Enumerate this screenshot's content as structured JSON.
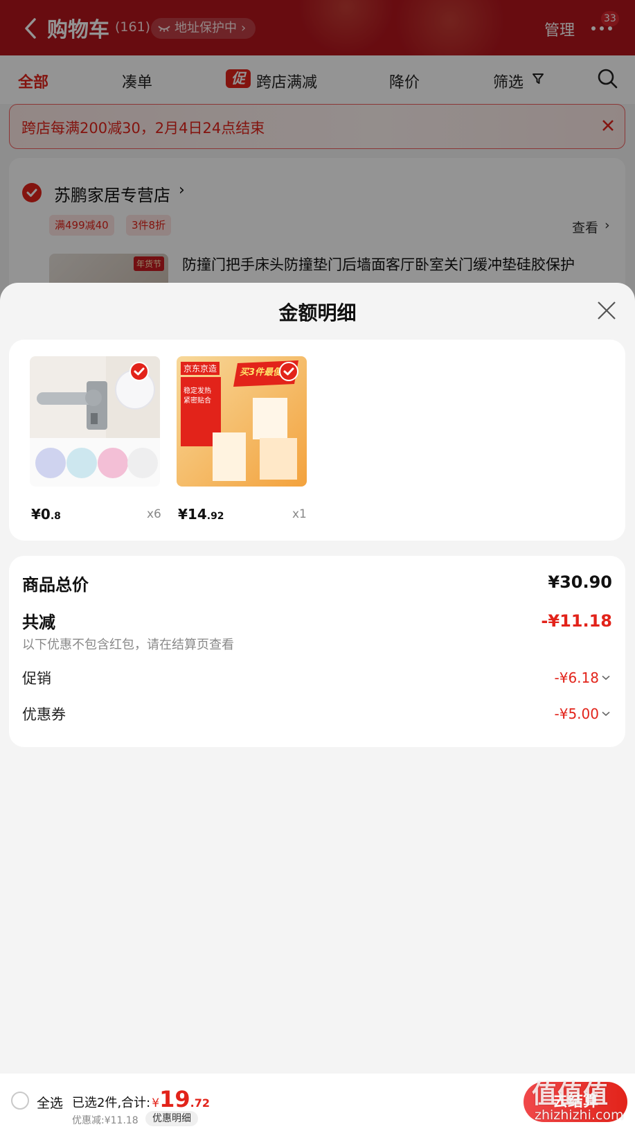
{
  "header": {
    "title": "购物车",
    "count": "(161)",
    "address_chip": "地址保护中",
    "manage": "管理",
    "message_badge": "33"
  },
  "tabs": [
    {
      "label": "全部",
      "active": true
    },
    {
      "label": "凑单"
    },
    {
      "label": "跨店满减",
      "badge": "促"
    },
    {
      "label": "降价"
    },
    {
      "label": "筛选"
    }
  ],
  "notice": "跨店每满200减30，2月4日24点结束",
  "store": {
    "name": "苏鹏家居专营店",
    "tags": [
      "满499减40",
      "3件8折"
    ],
    "see_more": "查看",
    "product_title": "防撞门把手床头防撞垫门后墙面客厅卧室关门缓冲垫硅胶保护",
    "product_thumb_tag": "年货节"
  },
  "sheet": {
    "title": "金额明细",
    "items": [
      {
        "price_int": "¥0",
        "price_dec": ".8",
        "qty": "x6"
      },
      {
        "price_int": "¥14",
        "price_dec": ".92",
        "qty": "x1",
        "brand_tag": "京东京造",
        "promo": "买3件最便宜",
        "box_title": "稳定发热 紧密贴合"
      }
    ],
    "summary": {
      "total_label": "商品总价",
      "total_value": "¥30.90",
      "reduce_label": "共减",
      "reduce_value": "-¥11.18",
      "reduce_note": "以下优惠不包含红包，请在结算页查看",
      "promo_label": "促销",
      "promo_value": "-¥6.18",
      "coupon_label": "优惠券",
      "coupon_value": "-¥5.00"
    }
  },
  "bottom": {
    "select_all": "全选",
    "selected": "已选2件,合计:",
    "currency": "¥",
    "total_int": "19",
    "total_dec": ".72",
    "discount": "优惠减:¥11.18",
    "detail_chip": "优惠明细",
    "checkout": "去结算",
    "watermark": "值值值",
    "watermark_sub": "zhizhizhi.com"
  },
  "colors": {
    "brand_red": "#e2231a",
    "header_red": "#b3151d"
  }
}
